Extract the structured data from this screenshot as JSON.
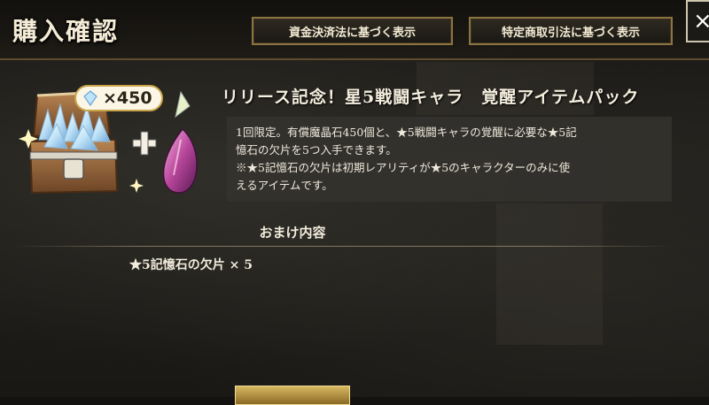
{
  "header": {
    "title": "購入確認",
    "btn_funds_settlement": "資金決済法に基づく表示",
    "btn_commercial_transactions": "特定商取引法に基づく表示",
    "close_label": "×"
  },
  "item": {
    "pack_title": "リリース記念！星5戦闘キャラ　覚醒アイテムパック",
    "badge_label": "×450",
    "description_line1": "1回限定。有償魔晶石450個と、★5戦闘キャラの覚醒に必要な★5記",
    "description_line2": "憶石の欠片を5つ入手できます。",
    "description_line3": "※★5記憶石の欠片は初期レアリティが★5のキャラクターのみに使",
    "description_line4": "えるアイテムです。"
  },
  "bonus": {
    "heading": "おまけ内容",
    "items": [
      {
        "label": "★5記憶石の欠片 × 5"
      }
    ]
  },
  "colors": {
    "accent_gold": "#8c7440",
    "text": "#ece6d8",
    "desc_bg": "#34322e"
  },
  "icons": [
    "treasure-chest-icon",
    "crystal-icon",
    "plus-icon",
    "memory-stone-shard-icon",
    "sparkle-icon",
    "close-icon"
  ]
}
